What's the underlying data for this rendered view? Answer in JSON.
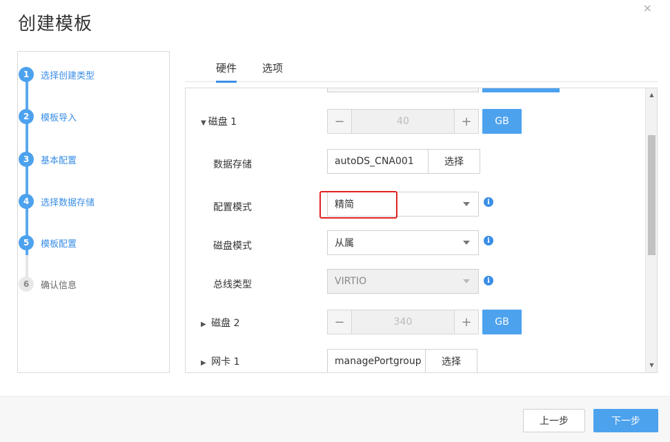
{
  "dialog": {
    "title": "创建模板",
    "close": "×"
  },
  "steps": [
    {
      "num": "1",
      "label": "选择创建类型"
    },
    {
      "num": "2",
      "label": "模板导入"
    },
    {
      "num": "3",
      "label": "基本配置"
    },
    {
      "num": "4",
      "label": "选择数据存储"
    },
    {
      "num": "5",
      "label": "模板配置"
    },
    {
      "num": "6",
      "label": "确认信息"
    }
  ],
  "tabs": [
    {
      "label": "硬件"
    },
    {
      "label": "选项"
    }
  ],
  "disk1": {
    "label": "磁盘 1",
    "expanded_icon": "▼",
    "size_value": "40",
    "unit": "GB",
    "minus": "−",
    "plus": "+",
    "datastore_label": "数据存储",
    "datastore_value": "autoDS_CNA001",
    "datastore_button": "选择",
    "config_mode_label": "配置模式",
    "config_mode_value": "精简",
    "disk_mode_label": "磁盘模式",
    "disk_mode_value": "从属",
    "bus_type_label": "总线类型",
    "bus_type_value": "VIRTIO"
  },
  "disk2": {
    "label": "磁盘 2",
    "collapsed_icon": "▶",
    "size_value": "340",
    "unit": "GB",
    "minus": "−",
    "plus": "+"
  },
  "nic1": {
    "label": "网卡 1",
    "collapsed_icon": "▶",
    "portgroup_value": "managePortgroup",
    "button": "选择"
  },
  "info_icon": "i",
  "footer": {
    "prev": "上一步",
    "next": "下一步"
  },
  "colors": {
    "accent": "#4da2ee",
    "highlight": "#e02020"
  }
}
